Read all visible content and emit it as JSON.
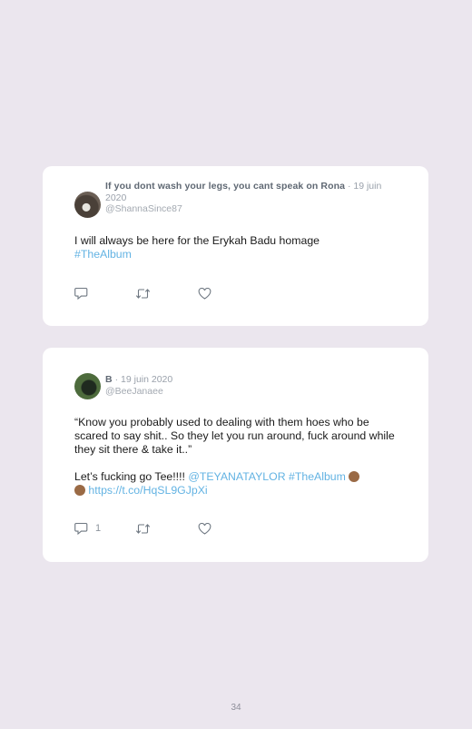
{
  "tweets": [
    {
      "author": "If you dont wash your legs, you cant speak on Rona",
      "date": "· 19 juin 2020",
      "handle": "@ShannaSince87",
      "text_lines": [
        "I will always be here for the Erykah Badu homage"
      ],
      "hashtag": "#TheAlbum",
      "reply_count": ""
    },
    {
      "author": "B",
      "date": "· 19 juin 2020",
      "handle": "@BeeJanaee",
      "quote": "“Know you probably used to dealing with them hoes who be scared to say shit.. So they let you run around, fuck around while they sit there & take it..”",
      "text_prefix": "Let’s fucking go Tee!!!! ",
      "mention": "@TEYANATAYLOR",
      "hashtag": "#TheAlbum",
      "url": "https://t.co/HqSL9GJpXi",
      "emoji": "clapping-hands-medium-dark-skin-tone",
      "reply_count": "1"
    }
  ],
  "icons": [
    "reply-icon",
    "retweet-icon",
    "like-icon"
  ],
  "page_number": "34"
}
